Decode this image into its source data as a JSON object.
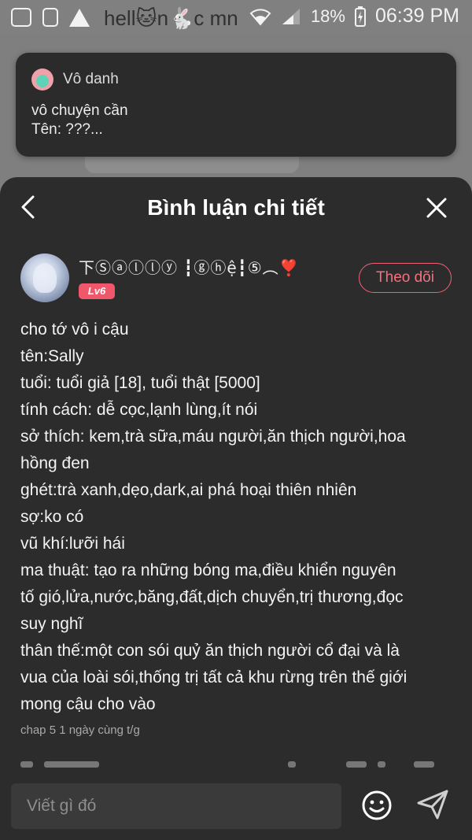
{
  "status_bar": {
    "background_title": "hell🐱n🐇c mn",
    "battery": "18%",
    "time": "06:39 PM"
  },
  "notification": {
    "sender": "Vô danh",
    "lines": [
      "vô chuyện cần",
      "Tên: ???..."
    ]
  },
  "sheet": {
    "title": "Bình luận chi tiết"
  },
  "comment": {
    "username": "下Ⓢⓐⓛⓛⓨ ┇ⓖⓗệ┇⑤︵❣️",
    "level": "Lv6",
    "follow_label": "Theo dõi",
    "lines": [
      "cho tớ vô i cậu",
      "tên:Sally",
      "tuổi: tuổi giả [18], tuổi thật [5000]",
      "tính cách: dễ cọc,lạnh lùng,ít nói",
      "sở thích: kem,trà sữa,máu người,ăn thịch người,hoa",
      "hồng đen",
      "ghét:trà xanh,dẹo,dark,ai phá hoại thiên nhiên",
      "sợ:ko có",
      "vũ khí:lưỡi hái",
      "ma thuật: tạo ra những bóng ma,điều khiển nguyên",
      "tố gió,lửa,nước,băng,đất,dịch chuyển,trị thương,đọc",
      "suy nghĩ",
      "thân thế:một con sói quỷ ăn thịch người cổ đại và là",
      "vua của loài sói,thống trị tất cả khu rừng trên thế giới",
      "mong cậu cho vào"
    ],
    "meta": "chap 5 1 ngày cùng t/g"
  },
  "input": {
    "placeholder": "Viết gì đó"
  },
  "icons": {
    "back": "chevron-left-icon",
    "close": "close-icon",
    "emoji": "smiley-icon",
    "send": "send-icon"
  },
  "colors": {
    "accent": "#f26076",
    "sheet_bg": "#2c2c2c",
    "input_bg": "#3a3a3a"
  }
}
